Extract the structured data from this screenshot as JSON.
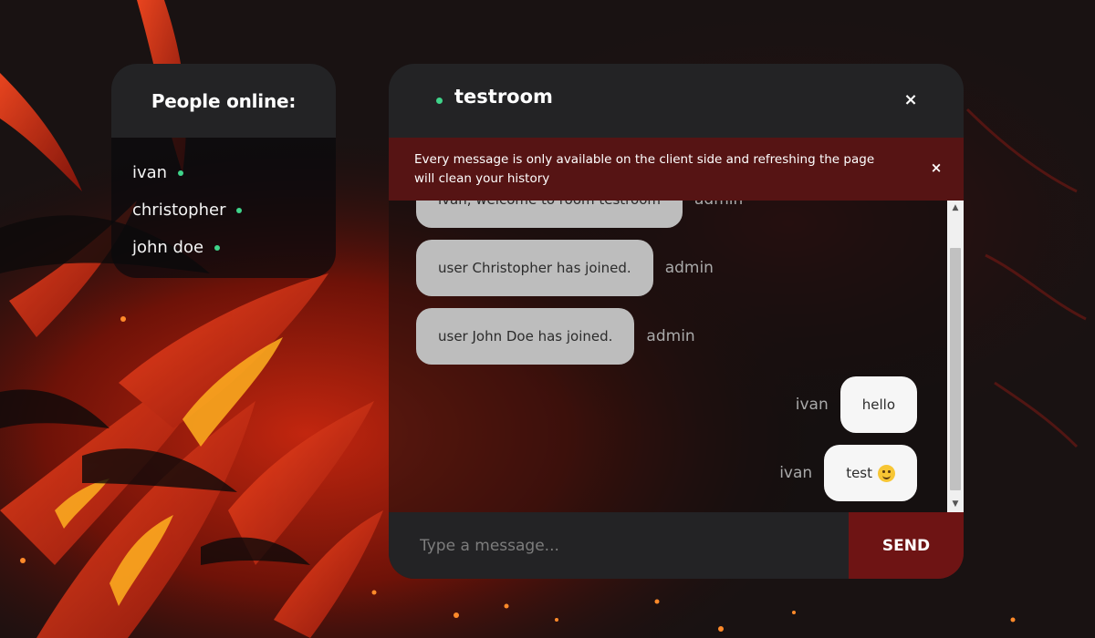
{
  "people_panel": {
    "title": "People online:",
    "users": [
      "ivan",
      "christopher",
      "john doe"
    ]
  },
  "room": {
    "name": "testroom",
    "close_icon": "×"
  },
  "notice": {
    "text": "Every message is only available on the client side and refreshing the page will clean your history",
    "close_icon": "×"
  },
  "messages": [
    {
      "text": "ivan, welcome to room testroom",
      "sender": "admin"
    },
    {
      "text": "user Christopher has joined.",
      "sender": "admin"
    },
    {
      "text": "user John Doe has joined.",
      "sender": "admin"
    },
    {
      "text": "hello",
      "sender": "ivan"
    },
    {
      "text": "test",
      "sender": "ivan",
      "emoji": "slightly-smiling-face"
    }
  ],
  "scrollbar": {
    "up_icon": "▲",
    "down_icon": "▼"
  },
  "composer": {
    "placeholder": "Type a message...",
    "send_label": "SEND"
  },
  "colors": {
    "online_dot": "#3fd48a",
    "notice_bg": "#561414",
    "send_bg": "#6e1414",
    "panel_header": "#232325"
  }
}
